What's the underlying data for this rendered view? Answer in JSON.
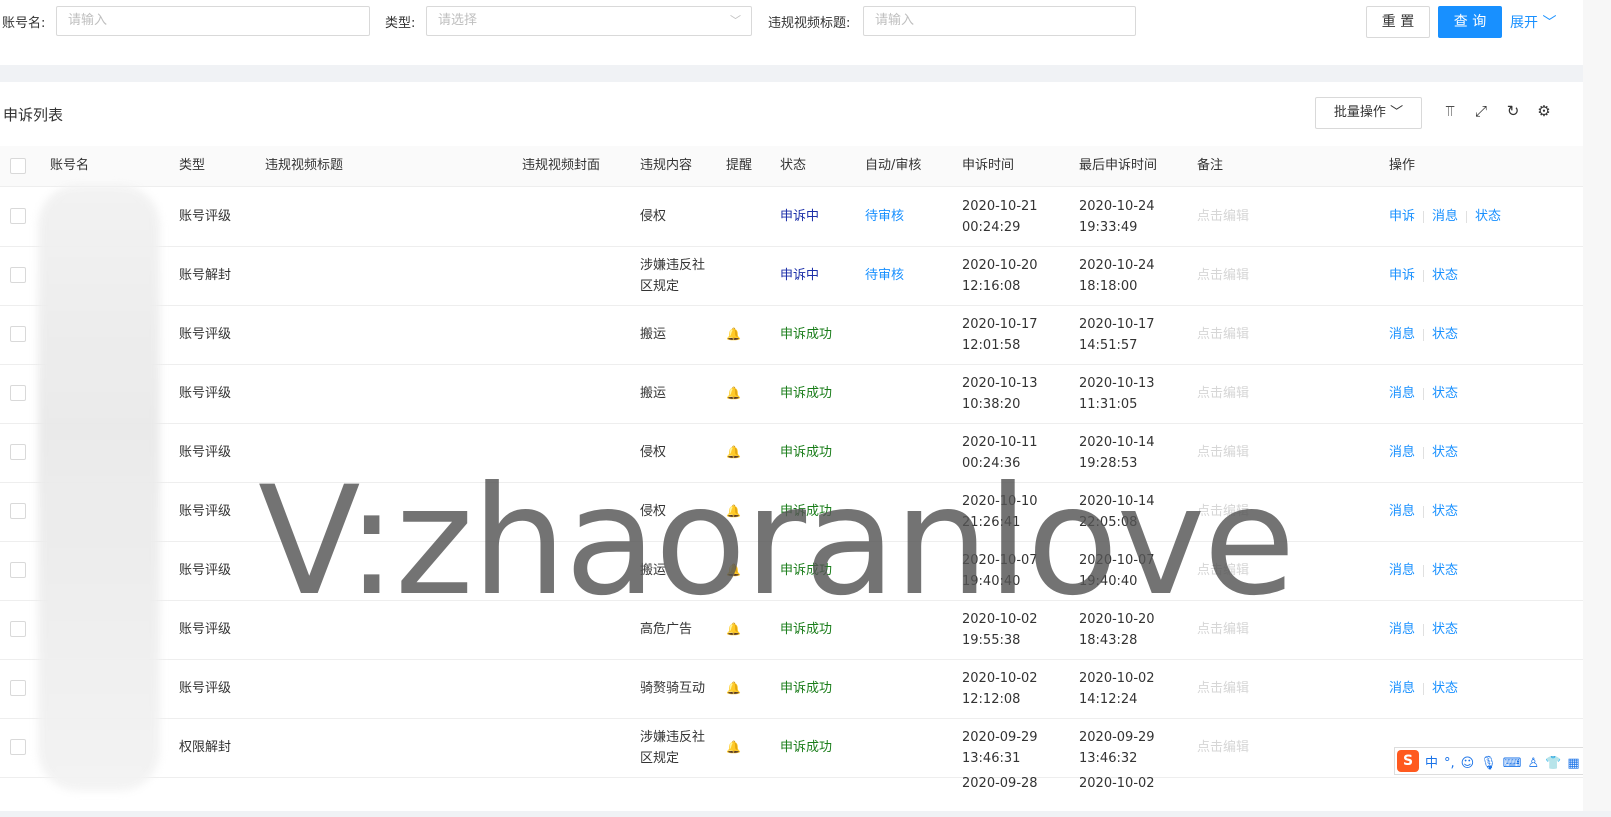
{
  "filter": {
    "account_label": "账号名:",
    "account_placeholder": "请输入",
    "type_label": "类型:",
    "type_placeholder": "请选择",
    "title_label": "违规视频标题:",
    "title_placeholder": "请输入",
    "reset_label": "重 置",
    "query_label": "查 询",
    "expand_label": "展开"
  },
  "panel": {
    "title": "申诉列表",
    "batch_label": "批量操作"
  },
  "table": {
    "headers": [
      "账号名",
      "类型",
      "违规视频标题",
      "违规视频封面",
      "违规内容",
      "提醒",
      "状态",
      "自动/审核",
      "申诉时间",
      "最后申诉时间",
      "备注",
      "操作"
    ],
    "rows": [
      {
        "type": "账号评级",
        "content": [
          "侵权"
        ],
        "bell": false,
        "status": "申诉中",
        "review": "待审核",
        "t1": [
          "2020-10-21",
          "00:24:29"
        ],
        "t2": [
          "2020-10-24",
          "19:33:49"
        ],
        "note": "点击编辑",
        "actions": [
          "申诉",
          "消息",
          "状态"
        ]
      },
      {
        "type": "账号解封",
        "content": [
          "涉嫌违反社",
          "区规定"
        ],
        "bell": false,
        "status": "申诉中",
        "review": "待审核",
        "t1": [
          "2020-10-20",
          "12:16:08"
        ],
        "t2": [
          "2020-10-24",
          "18:18:00"
        ],
        "note": "点击编辑",
        "actions": [
          "申诉",
          "状态"
        ]
      },
      {
        "type": "账号评级",
        "content": [
          "搬运"
        ],
        "bell": true,
        "status": "申诉成功",
        "review": "",
        "t1": [
          "2020-10-17",
          "12:01:58"
        ],
        "t2": [
          "2020-10-17",
          "14:51:57"
        ],
        "note": "点击编辑",
        "actions": [
          "消息",
          "状态"
        ]
      },
      {
        "type": "账号评级",
        "content": [
          "搬运"
        ],
        "bell": true,
        "status": "申诉成功",
        "review": "",
        "t1": [
          "2020-10-13",
          "10:38:20"
        ],
        "t2": [
          "2020-10-13",
          "11:31:05"
        ],
        "note": "点击编辑",
        "actions": [
          "消息",
          "状态"
        ]
      },
      {
        "type": "账号评级",
        "content": [
          "侵权"
        ],
        "bell": true,
        "status": "申诉成功",
        "review": "",
        "t1": [
          "2020-10-11",
          "00:24:36"
        ],
        "t2": [
          "2020-10-14",
          "19:28:53"
        ],
        "note": "点击编辑",
        "actions": [
          "消息",
          "状态"
        ]
      },
      {
        "type": "账号评级",
        "content": [
          "侵权"
        ],
        "bell": true,
        "status": "申诉成功",
        "review": "",
        "t1": [
          "2020-10-10",
          "21:26:41"
        ],
        "t2": [
          "2020-10-14",
          "22:05:08"
        ],
        "note": "点击编辑",
        "actions": [
          "消息",
          "状态"
        ]
      },
      {
        "type": "账号评级",
        "content": [
          "搬运"
        ],
        "bell": true,
        "status": "申诉成功",
        "review": "",
        "t1": [
          "2020-10-07",
          "19:40:40"
        ],
        "t2": [
          "2020-10-07",
          "19:40:40"
        ],
        "note": "点击编辑",
        "actions": [
          "消息",
          "状态"
        ]
      },
      {
        "type": "账号评级",
        "content": [
          "高危广告"
        ],
        "bell": true,
        "status": "申诉成功",
        "review": "",
        "t1": [
          "2020-10-02",
          "19:55:38"
        ],
        "t2": [
          "2020-10-20",
          "18:43:28"
        ],
        "note": "点击编辑",
        "actions": [
          "消息",
          "状态"
        ]
      },
      {
        "type": "账号评级",
        "content": [
          "骑赘骑互动"
        ],
        "bell": true,
        "status": "申诉成功",
        "review": "",
        "t1": [
          "2020-10-02",
          "12:12:08"
        ],
        "t2": [
          "2020-10-02",
          "14:12:24"
        ],
        "note": "点击编辑",
        "actions": [
          "消息",
          "状态"
        ]
      },
      {
        "type": "权限解封",
        "content": [
          "涉嫌违反社",
          "区规定"
        ],
        "bell": true,
        "status": "申诉成功",
        "review": "",
        "t1": [
          "2020-09-29",
          "13:46:31"
        ],
        "t2": [
          "2020-09-29",
          "13:46:32"
        ],
        "note": "点击编辑",
        "actions": []
      }
    ],
    "partial_row": {
      "t1": "2020-09-28",
      "t2": "2020-10-02"
    }
  },
  "overlay": {
    "watermark": "V:zhaoranlove",
    "ime_items": [
      "中",
      "°,",
      "☺",
      "🎙",
      "⌨",
      "♙",
      "👕",
      "▦"
    ],
    "ime_logo": "S"
  },
  "colors": {
    "primary": "#1890ff",
    "success": "#1a7d1a",
    "processing": "#1c2fa8",
    "bell": "#f4b400"
  }
}
